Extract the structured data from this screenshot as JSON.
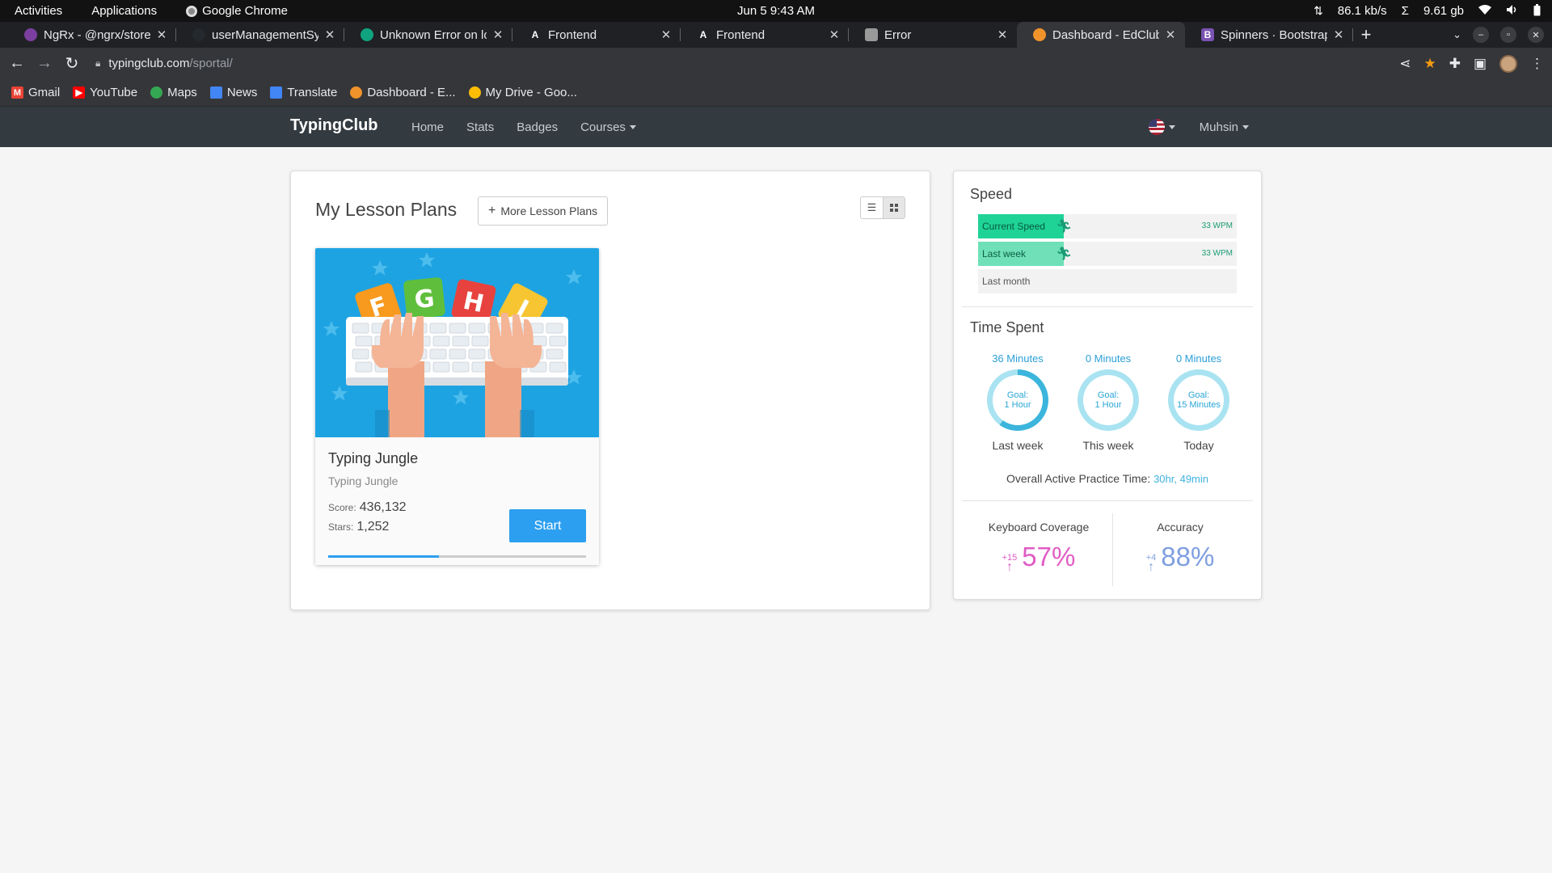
{
  "os": {
    "activities": "Activities",
    "applications": "Applications",
    "chrome_app": "Google Chrome",
    "clock": "Jun 5  9:43 AM",
    "net_speed": "86.1 kb/s",
    "sigma": "Σ",
    "storage": "9.61 gb"
  },
  "tabs": [
    {
      "title": "NgRx - @ngrx/store-d",
      "icon": "ngrx-icon",
      "color": "#7b3fa0"
    },
    {
      "title": "userManagementSys",
      "icon": "github-icon",
      "color": "#24292e"
    },
    {
      "title": "Unknown Error on lo",
      "icon": "chatgpt-icon",
      "color": "#10a37f"
    },
    {
      "title": "Frontend",
      "icon": "angular-icon",
      "color": "#ffffff"
    },
    {
      "title": "Frontend",
      "icon": "angular-icon",
      "color": "#ffffff"
    },
    {
      "title": "Error",
      "icon": "error-page-icon",
      "color": "#999999"
    },
    {
      "title": "Dashboard - EdClub",
      "icon": "edclub-icon",
      "color": "#f0932b",
      "active": true
    },
    {
      "title": "Spinners · Bootstrap",
      "icon": "bootstrap-icon",
      "color": "#7952b3"
    }
  ],
  "address": {
    "domain": "typingclub.com",
    "path": "/sportal/"
  },
  "bookmarks": [
    {
      "label": "Gmail",
      "icon": "gmail-icon",
      "color": "#ea4335"
    },
    {
      "label": "YouTube",
      "icon": "youtube-icon",
      "color": "#ff0000"
    },
    {
      "label": "Maps",
      "icon": "maps-icon",
      "color": "#34a853"
    },
    {
      "label": "News",
      "icon": "news-icon",
      "color": "#4285f4"
    },
    {
      "label": "Translate",
      "icon": "translate-icon",
      "color": "#4285f4"
    },
    {
      "label": "Dashboard - E...",
      "icon": "edclub-icon",
      "color": "#f0932b"
    },
    {
      "label": "My Drive - Goo...",
      "icon": "drive-icon",
      "color": "#fbbc04"
    }
  ],
  "site_nav": {
    "brand": "TypingClub",
    "links": [
      "Home",
      "Stats",
      "Badges",
      "Courses"
    ],
    "user": "Muhsin"
  },
  "lesson_plans": {
    "title": "My Lesson Plans",
    "more_button": "More Lesson Plans",
    "card": {
      "title": "Typing Jungle",
      "subtitle": "Typing Jungle",
      "score_label": "Score:",
      "score": "436,132",
      "stars_label": "Stars:",
      "stars": "1,252",
      "start": "Start",
      "progress": 0.43,
      "image_letters": [
        "F",
        "G",
        "H",
        "J"
      ]
    }
  },
  "speed": {
    "title": "Speed",
    "rows": [
      {
        "label": "Current Speed",
        "value": "33 WPM",
        "level": 0.33,
        "color": "#1fd396"
      },
      {
        "label": "Last week",
        "value": "33 WPM",
        "level": 0.33,
        "color": "#6fe0b8"
      },
      {
        "label": "Last month",
        "value": "",
        "level": 0,
        "color": "#6fe0b8"
      }
    ]
  },
  "time_spent": {
    "title": "Time Spent",
    "rings": [
      {
        "top": "36 Minutes",
        "goal_label": "Goal:",
        "goal": "1 Hour",
        "bottom": "Last week",
        "progress": 0.6
      },
      {
        "top": "0 Minutes",
        "goal_label": "Goal:",
        "goal": "1 Hour",
        "bottom": "This week",
        "progress": 0
      },
      {
        "top": "0 Minutes",
        "goal_label": "Goal:",
        "goal": "15 Minutes",
        "bottom": "Today",
        "progress": 0
      }
    ],
    "overall_label": "Overall Active Practice Time:",
    "overall_value": "30hr, 49min"
  },
  "metrics": {
    "coverage": {
      "label": "Keyboard Coverage",
      "delta": "+15",
      "value": "57%",
      "color": "#e05cc4"
    },
    "accuracy": {
      "label": "Accuracy",
      "delta": "+4",
      "value": "88%",
      "color": "#7f9fe0"
    }
  }
}
